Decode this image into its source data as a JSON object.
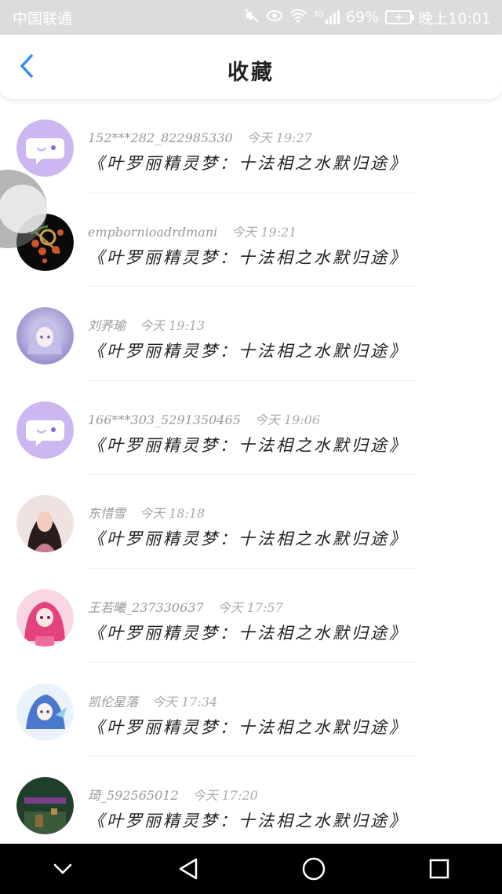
{
  "status_bar": {
    "carrier": "中国联通",
    "network": "3G",
    "battery_percent": "69%",
    "time": "晚上10:01"
  },
  "header": {
    "title": "收藏",
    "back_icon": "chevron-left-icon",
    "accent_color": "#2f8ef0"
  },
  "items": [
    {
      "user": "152***282_822985330",
      "time": "今天 19:27",
      "title": "《叶罗丽精灵梦：十法相之水默归途》",
      "avatar": "chat-bubble-avatar"
    },
    {
      "user": "empbornioadrdmani",
      "time": "今天 19:21",
      "title": "《叶罗丽精灵梦：十法相之水默归途》",
      "avatar": "ornament-avatar"
    },
    {
      "user": "刘荞瑜",
      "time": "今天 19:13",
      "title": "《叶罗丽精灵梦：十法相之水默归途》",
      "avatar": "anime-girl-avatar"
    },
    {
      "user": "166***303_5291350465",
      "time": "今天 19:06",
      "title": "《叶罗丽精灵梦：十法相之水默归途》",
      "avatar": "chat-bubble-avatar"
    },
    {
      "user": "东惜雪",
      "time": "今天 18:18",
      "title": "《叶罗丽精灵梦：十法相之水默归途》",
      "avatar": "photo-avatar"
    },
    {
      "user": "王若曦_237330637",
      "time": "今天 17:57",
      "title": "《叶罗丽精灵梦：十法相之水默归途》",
      "avatar": "pink-anime-avatar"
    },
    {
      "user": "凯伦星落",
      "time": "今天 17:34",
      "title": "《叶罗丽精灵梦：十法相之水默归途》",
      "avatar": "blue-anime-avatar"
    },
    {
      "user": "琦_592565012",
      "time": "今天 17:20",
      "title": "《叶罗丽精灵梦：十法相之水默归途》",
      "avatar": "game-avatar"
    }
  ],
  "nav_bar": {
    "buttons": [
      "chevron-down-icon",
      "back-triangle-icon",
      "home-circle-icon",
      "recents-square-icon"
    ]
  }
}
